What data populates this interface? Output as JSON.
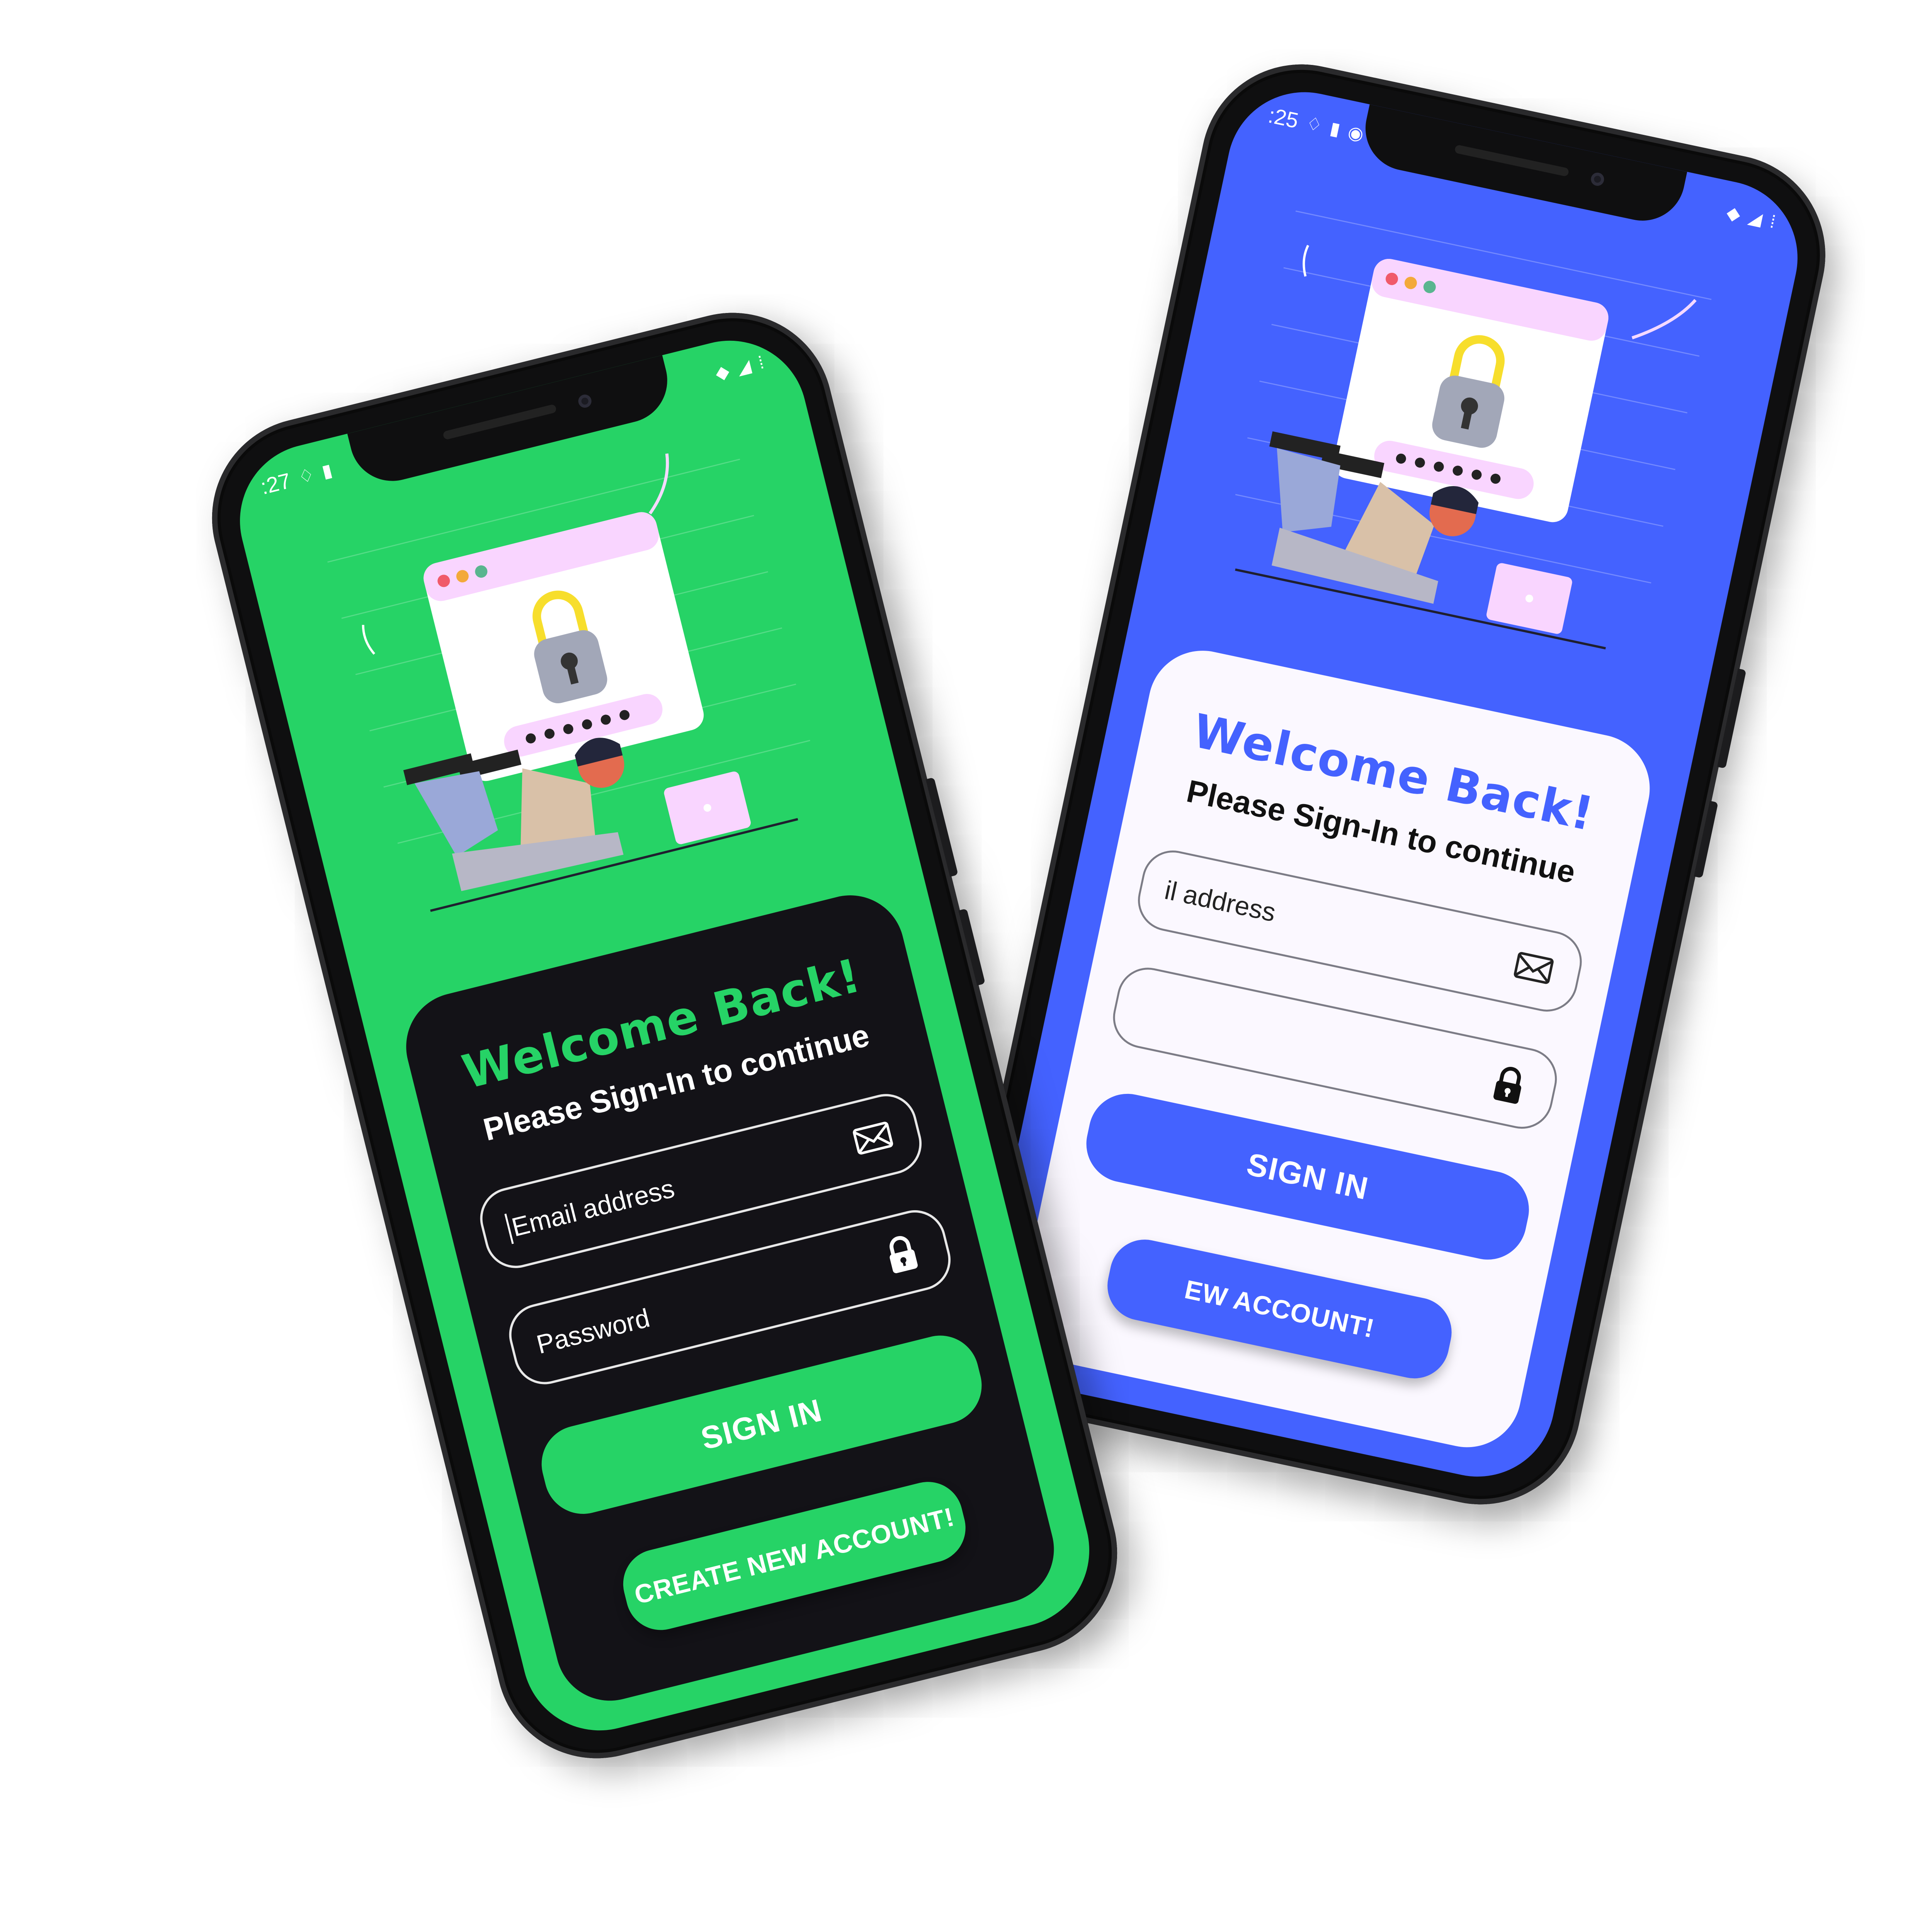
{
  "colors": {
    "green": "#26d366",
    "blue": "#4462ff",
    "dark_card": "#131217",
    "light_card": "#fbf8ff"
  },
  "phones": {
    "green": {
      "status": {
        "time": ":27",
        "icons_left": [
          "notification-icon",
          "sd-card-icon"
        ],
        "icons_right": [
          "wifi-icon",
          "signal-icon",
          "dots-icon"
        ]
      },
      "login": {
        "title": "Welcome Back!",
        "subtitle": "Please Sign-In to continue",
        "email_placeholder": "Email address",
        "password_placeholder": "Password",
        "sign_in_label": "SIGN IN",
        "create_account_label": "CREATE NEW ACCOUNT!"
      }
    },
    "blue": {
      "status": {
        "time": ":25",
        "icons_left": [
          "notification-icon",
          "sd-card-icon",
          "sync-icon"
        ],
        "icons_right": [
          "wifi-icon",
          "signal-icon",
          "dots-icon"
        ]
      },
      "login": {
        "title": "Welcome Back!",
        "subtitle": "Please Sign-In to continue",
        "email_placeholder": "il address",
        "sign_in_label": "SIGN IN",
        "create_account_label": "EW ACCOUNT!"
      }
    }
  }
}
